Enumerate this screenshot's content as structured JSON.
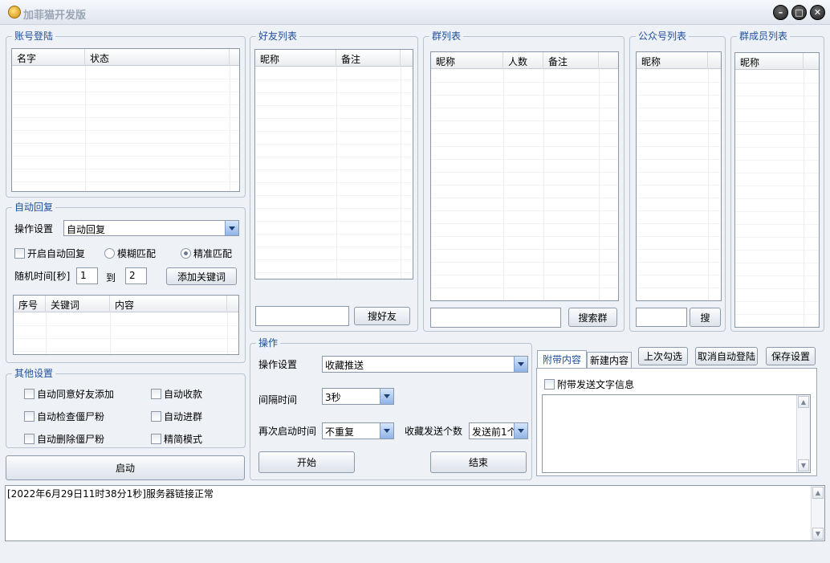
{
  "window": {
    "title": "加菲猫开发版"
  },
  "account": {
    "title": "账号登陆",
    "columns": [
      "名字",
      "状态"
    ]
  },
  "friends": {
    "title": "好友列表",
    "columns": [
      "昵称",
      "备注"
    ],
    "search_placeholder": "",
    "search_button": "搜好友"
  },
  "groups": {
    "title": "群列表",
    "columns": [
      "昵称",
      "人数",
      "备注"
    ],
    "search_placeholder": "",
    "search_button": "搜索群"
  },
  "official": {
    "title": "公众号列表",
    "columns": [
      "昵称"
    ],
    "search_placeholder": "",
    "search_button": "搜"
  },
  "members": {
    "title": "群成员列表",
    "columns": [
      "昵称"
    ]
  },
  "auto_reply": {
    "title": "自动回复",
    "op_label": "操作设置",
    "op_value": "自动回复",
    "enable_label": "开启自动回复",
    "fuzzy_label": "模糊匹配",
    "exact_label": "精准匹配",
    "random_label": "随机时间[秒]",
    "time_from": "1",
    "to_label": "到",
    "time_to": "2",
    "add_keyword_button": "添加关键词",
    "columns": [
      "序号",
      "关键词",
      "内容"
    ]
  },
  "other": {
    "title": "其他设置",
    "opt1": "自动同意好友添加",
    "opt2": "自动收款",
    "opt3": "自动检查僵尸粉",
    "opt4": "自动进群",
    "opt5": "自动删除僵尸粉",
    "opt6": "精简模式"
  },
  "start_button": "启动",
  "operation": {
    "title": "操作",
    "op_label": "操作设置",
    "op_value": "收藏推送",
    "interval_label": "间隔时间",
    "interval_value": "3秒",
    "restart_label": "再次启动时间",
    "restart_value": "不重复",
    "count_label": "收藏发送个数",
    "count_value": "发送前1个",
    "begin_button": "开始",
    "end_button": "结束"
  },
  "attach": {
    "tab1": "附带内容",
    "tab2": "新建内容",
    "last_check_button": "上次勾选",
    "cancel_auto_login_button": "取消自动登陆",
    "save_settings_button": "保存设置",
    "attach_text_label": "附带发送文字信息"
  },
  "log": {
    "line1": "[2022年6月29日11时38分1秒]服务器链接正常"
  },
  "colors": {
    "accent": "#1f4f9c",
    "border": "#b8c4d4",
    "background": "#eef1f6"
  }
}
